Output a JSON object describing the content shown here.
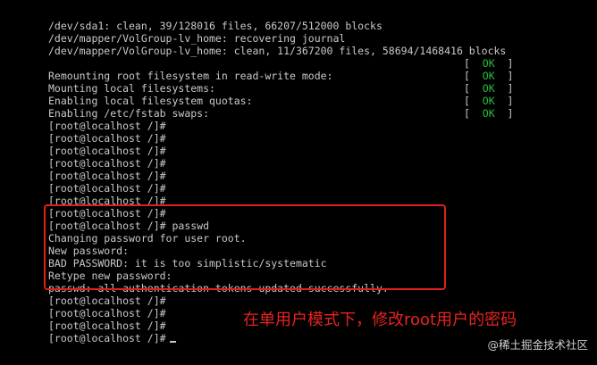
{
  "terminal": {
    "lines": [
      {
        "text": "/dev/sda1: clean, 39/128016 files, 66207/512000 blocks"
      },
      {
        "text": "/dev/mapper/VolGroup-lv_home: recovering journal"
      },
      {
        "text": "/dev/mapper/VolGroup-lv_home: clean, 11/367200 files, 58694/1468416 blocks"
      },
      {
        "text": "",
        "status": {
          "open": "[  ",
          "ok": "OK",
          "close": "  ]"
        }
      },
      {
        "text": "Remounting root filesystem in read-write mode:",
        "status": {
          "open": "[  ",
          "ok": "OK",
          "close": "  ]"
        }
      },
      {
        "text": "Mounting local filesystems:",
        "status": {
          "open": "[  ",
          "ok": "OK",
          "close": "  ]"
        }
      },
      {
        "text": "Enabling local filesystem quotas:",
        "status": {
          "open": "[  ",
          "ok": "OK",
          "close": "  ]"
        }
      },
      {
        "text": "Enabling /etc/fstab swaps:",
        "status": {
          "open": "[  ",
          "ok": "OK",
          "close": "  ]"
        }
      },
      {
        "text": "[root@localhost /]#"
      },
      {
        "text": "[root@localhost /]#"
      },
      {
        "text": "[root@localhost /]#"
      },
      {
        "text": "[root@localhost /]#"
      },
      {
        "text": "[root@localhost /]#"
      },
      {
        "text": "[root@localhost /]#"
      },
      {
        "text": "[root@localhost /]#"
      },
      {
        "text": "[root@localhost /]#"
      },
      {
        "text": "[root@localhost /]# passwd"
      },
      {
        "text": "Changing password for user root."
      },
      {
        "text": "New password:"
      },
      {
        "text": "BAD PASSWORD: it is too simplistic/systematic"
      },
      {
        "text": "Retype new password:"
      },
      {
        "text": "passwd: all authentication tokens updated successfully."
      },
      {
        "text": "[root@localhost /]#"
      },
      {
        "text": "[root@localhost /]#"
      },
      {
        "text": "[root@localhost /]#"
      },
      {
        "text": "[root@localhost /]#",
        "cursor": true
      }
    ]
  },
  "annotation": {
    "text": "在单用户模式下，修改root用户的密码",
    "color": "#e8231d"
  },
  "watermark": {
    "text": "@稀土掘金技术社区"
  },
  "colors": {
    "background": "#000000",
    "text": "#c9c9c9",
    "ok": "#27c03b",
    "highlight_border": "#e0201b"
  }
}
